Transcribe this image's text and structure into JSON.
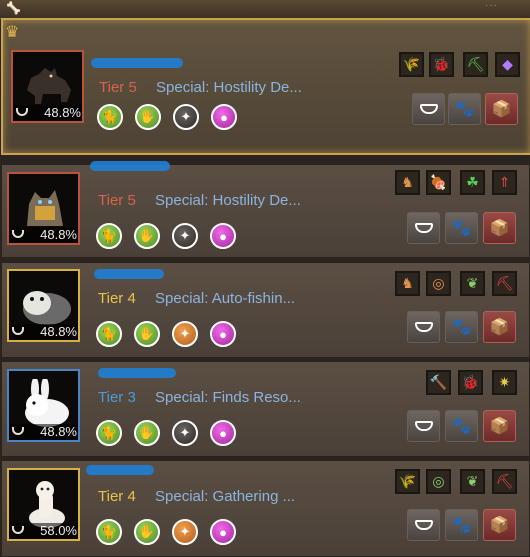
{
  "window": {
    "top_icon": "bone-icon",
    "dots": "···"
  },
  "buttons": {
    "feed": "feed-icon",
    "pet_care": "paw-icon",
    "exchange": "box-icon"
  },
  "pets": [
    {
      "tier": "Tier 5",
      "special": "Special: Hostility De...",
      "hunger": "48.8%",
      "tier_color": "#d8624a",
      "crowned": true,
      "traits": [
        "green",
        "green",
        "dark",
        "purple"
      ],
      "skills": [
        "wheat-icon",
        "bug-icon",
        "pickaxe-icon",
        "crystal-icon"
      ]
    },
    {
      "tier": "Tier 5",
      "special": "Special: Hostility De...",
      "hunger": "48.8%",
      "tier_color": "#d8624a",
      "traits": [
        "green",
        "green",
        "dark",
        "purple"
      ],
      "skills": [
        "horse-icon",
        "meat-icon",
        "clover-icon",
        "arrow-icon"
      ]
    },
    {
      "tier": "Tier 4",
      "special": "Special: Auto-fishin...",
      "hunger": "48.8%",
      "tier_color": "#e6c44c",
      "traits": [
        "green",
        "green",
        "orange",
        "purple"
      ],
      "skills": [
        "horse-icon",
        "compass-icon",
        "feather-icon",
        "pickaxe-icon"
      ]
    },
    {
      "tier": "Tier 3",
      "special": "Special: Finds Reso...",
      "hunger": "48.8%",
      "tier_color": "#4c9ad8",
      "traits": [
        "green",
        "green",
        "dark",
        "purple"
      ],
      "skills": [
        "hammer-icon",
        "bug-icon",
        "sparkle-icon"
      ]
    },
    {
      "tier": "Tier 4",
      "special": "Special: Gathering ...",
      "hunger": "58.0%",
      "tier_color": "#e6c44c",
      "traits": [
        "green",
        "green",
        "orange",
        "purple"
      ],
      "skills": [
        "wheat-icon",
        "compass-icon",
        "feather-icon",
        "pickaxe-icon"
      ]
    }
  ]
}
